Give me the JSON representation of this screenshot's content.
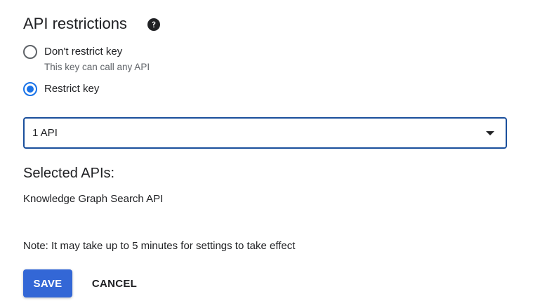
{
  "section": {
    "title": "API restrictions",
    "help_icon": "help-circle-icon"
  },
  "restrictions": {
    "options": [
      {
        "label": "Don't restrict key",
        "description": "This key can call any API",
        "selected": false
      },
      {
        "label": "Restrict key",
        "description": "",
        "selected": true
      }
    ]
  },
  "api_select": {
    "value": "1 API",
    "icon": "dropdown-arrow-icon"
  },
  "selected_apis": {
    "heading": "Selected APIs:",
    "items": [
      "Knowledge Graph Search API"
    ]
  },
  "note": "Note: It may take up to 5 minutes for settings to take effect",
  "actions": {
    "save_label": "SAVE",
    "cancel_label": "CANCEL"
  },
  "colors": {
    "primary": "#1a73e8",
    "save_button": "#3367d6",
    "select_border": "#1a4f9c",
    "text": "#202124",
    "secondary_text": "#5f6368"
  }
}
